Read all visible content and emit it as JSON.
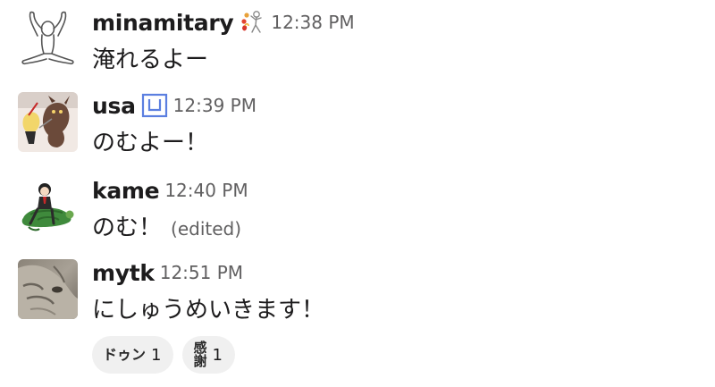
{
  "messages": [
    {
      "username": "minamitary",
      "status_icon": "juggler-emoji-icon",
      "timestamp": "12:38 PM",
      "text": "淹れるよー"
    },
    {
      "username": "usa",
      "status_icon": "blue-box-emoji-icon",
      "timestamp": "12:39 PM",
      "text": "のむよー！"
    },
    {
      "username": "kame",
      "timestamp": "12:40 PM",
      "text": "のむ！",
      "edited_label": "(edited)"
    },
    {
      "username": "mytk",
      "timestamp": "12:51 PM",
      "text": "にしゅうめいきます！",
      "reactions": [
        {
          "emoji_text": "ドゥン",
          "count": "1"
        },
        {
          "emoji_text_top": "感",
          "emoji_text_bottom": "謝",
          "count": "1"
        }
      ]
    }
  ],
  "colors": {
    "text": "#1d1c1d",
    "muted": "#616061",
    "reaction_bg": "#f0f0f0",
    "status_blue": "#5b7fe0"
  }
}
